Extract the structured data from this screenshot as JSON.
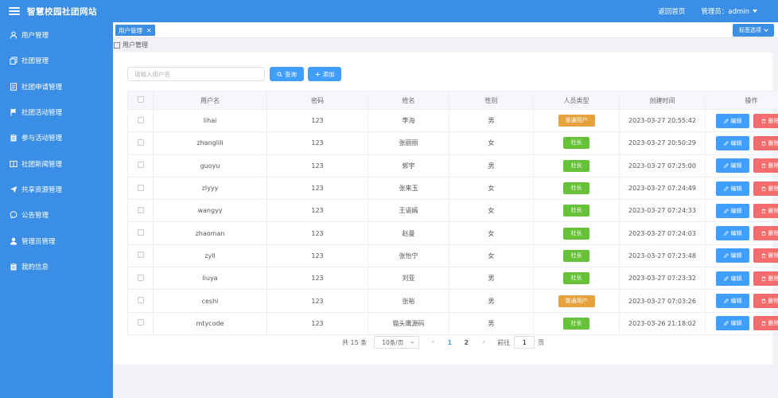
{
  "app": {
    "title": "智慧校园社团网站"
  },
  "header": {
    "home_link": "返回首页",
    "admin_label": "管理员：admin"
  },
  "sidebar": {
    "items": [
      {
        "label": "用户管理",
        "icon": "user-icon"
      },
      {
        "label": "社团管理",
        "icon": "copy-icon"
      },
      {
        "label": "社团申请管理",
        "icon": "document-icon"
      },
      {
        "label": "社团活动管理",
        "icon": "flag-icon"
      },
      {
        "label": "参与活动管理",
        "icon": "clipboard-icon"
      },
      {
        "label": "社团新闻管理",
        "icon": "book-icon"
      },
      {
        "label": "共享资源管理",
        "icon": "send-icon"
      },
      {
        "label": "公告管理",
        "icon": "chat-icon"
      },
      {
        "label": "管理员管理",
        "icon": "person-icon"
      },
      {
        "label": "我的信息",
        "icon": "clipboard-icon"
      }
    ]
  },
  "tabs": {
    "active_tab": "用户管理",
    "options_label": "标签选项"
  },
  "breadcrumb": "用户管理",
  "toolbar": {
    "search_placeholder": "请输入用户名",
    "query_label": "查询",
    "add_label": "添加"
  },
  "table": {
    "columns": [
      "",
      "用户名",
      "密码",
      "姓名",
      "性别",
      "人员类型",
      "创建时间",
      "操作"
    ],
    "rows": [
      {
        "username": "lihai",
        "password": "123",
        "name": "李海",
        "gender": "男",
        "type": "普通用户",
        "created": "2023-03-27 20:55:42"
      },
      {
        "username": "zhanglili",
        "password": "123",
        "name": "张丽丽",
        "gender": "女",
        "type": "社长",
        "created": "2023-03-27 20:50:29"
      },
      {
        "username": "guoyu",
        "password": "123",
        "name": "郭宇",
        "gender": "男",
        "type": "社长",
        "created": "2023-03-27 07:25:00"
      },
      {
        "username": "zlyyy",
        "password": "123",
        "name": "张来玉",
        "gender": "女",
        "type": "社长",
        "created": "2023-03-27 07:24:49"
      },
      {
        "username": "wangyy",
        "password": "123",
        "name": "王语嫣",
        "gender": "女",
        "type": "社长",
        "created": "2023-03-27 07:24:33"
      },
      {
        "username": "zhaoman",
        "password": "123",
        "name": "赵曼",
        "gender": "女",
        "type": "社长",
        "created": "2023-03-27 07:24:03"
      },
      {
        "username": "zyll",
        "password": "123",
        "name": "张怡宁",
        "gender": "女",
        "type": "社长",
        "created": "2023-03-27 07:23:48"
      },
      {
        "username": "liuya",
        "password": "123",
        "name": "刘亚",
        "gender": "男",
        "type": "社长",
        "created": "2023-03-27 07:23:32"
      },
      {
        "username": "ceshi",
        "password": "123",
        "name": "张裕",
        "gender": "男",
        "type": "普通用户",
        "created": "2023-03-27 07:03:26"
      },
      {
        "username": "mtycode",
        "password": "123",
        "name": "猫头鹰源码",
        "gender": "男",
        "type": "社长",
        "created": "2023-03-26 21:18:02"
      }
    ],
    "edit_label": "编辑",
    "delete_label": "删除"
  },
  "pagination": {
    "total_text": "共 15 条",
    "page_size": "10条/页",
    "prev": "‹",
    "pages": [
      "1",
      "2"
    ],
    "current_page": "1",
    "next": "›",
    "goto_prefix": "前往",
    "goto_value": "1",
    "goto_suffix": "页"
  },
  "colors": {
    "primary": "#3a8ee6",
    "button_blue": "#409eff",
    "tag_normal": "#e6a23c",
    "tag_leader": "#67c23a",
    "delete_red": "#f56c6c"
  }
}
